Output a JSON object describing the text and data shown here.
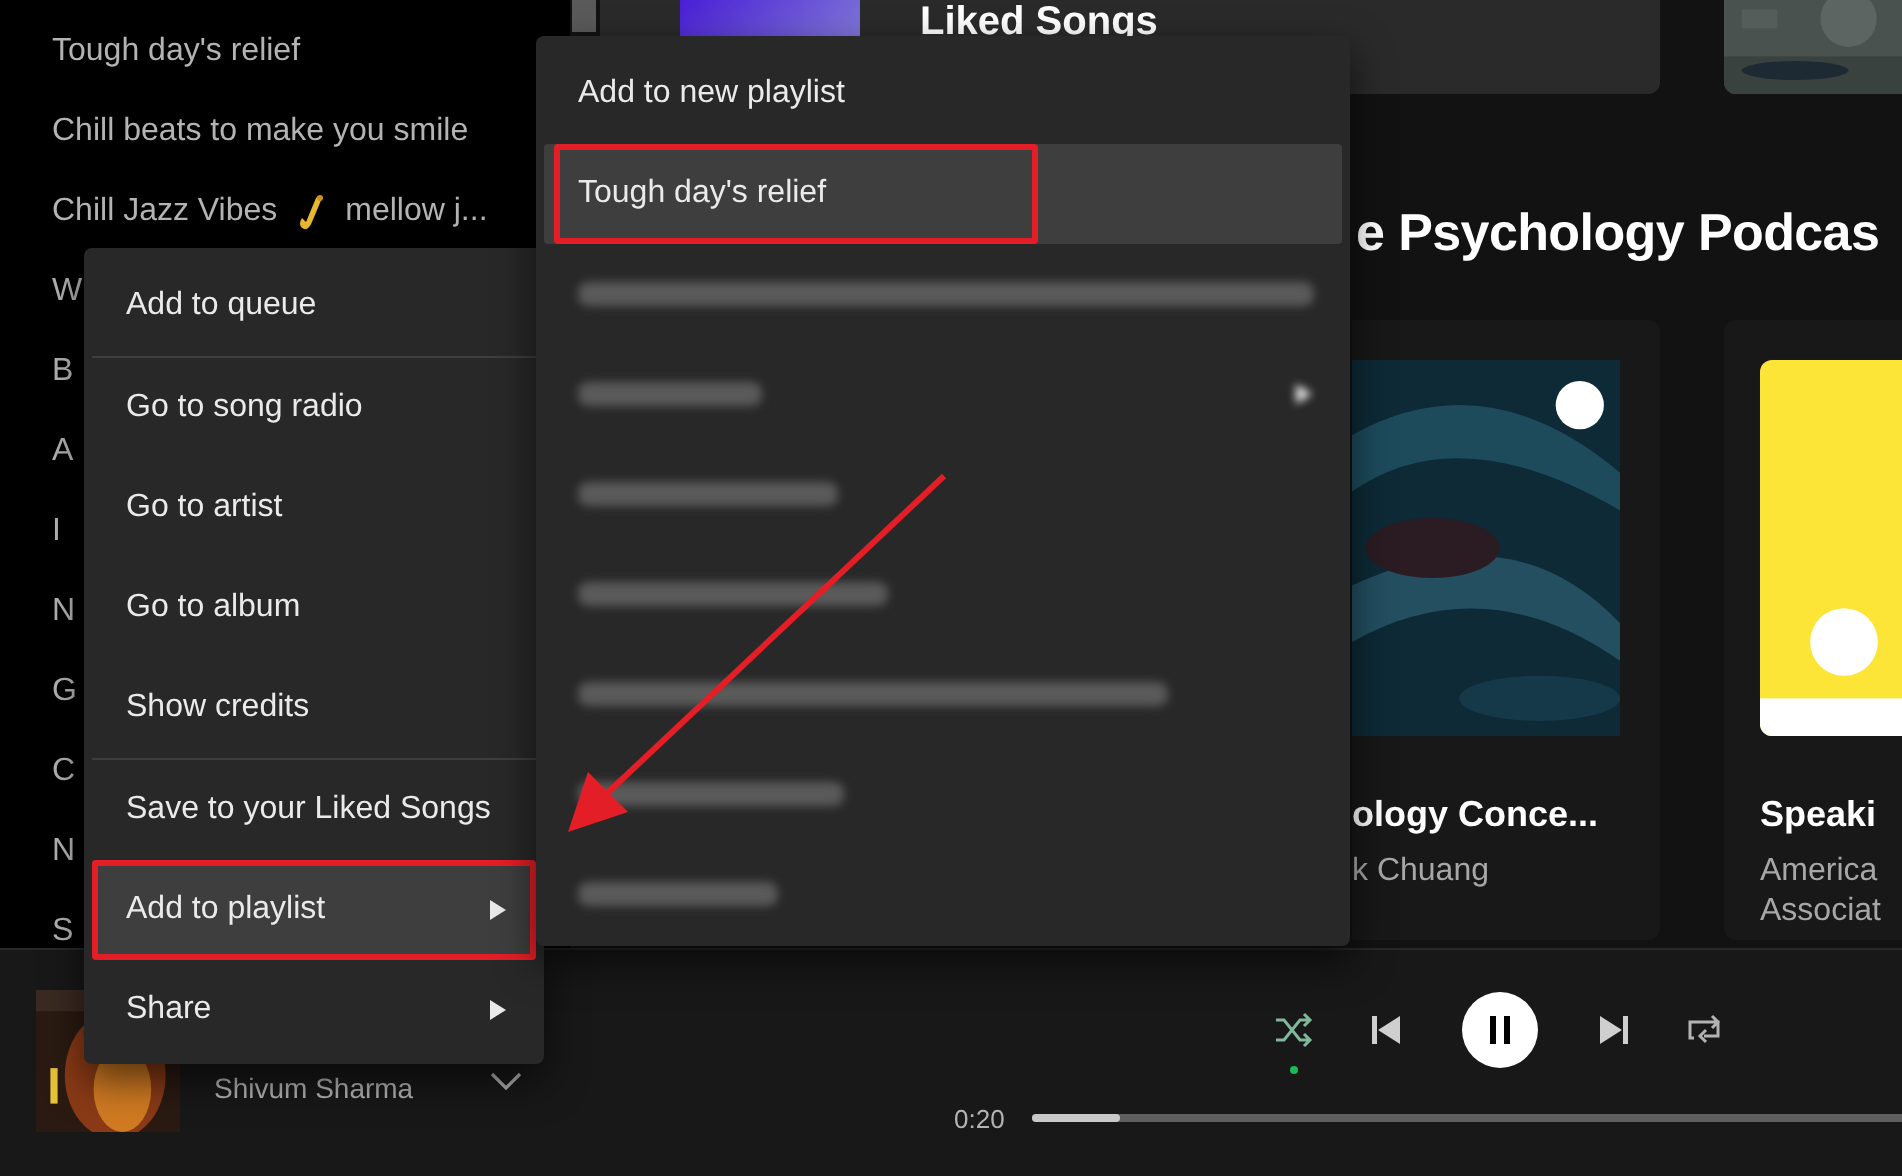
{
  "sidebar": {
    "playlists": [
      {
        "kind": "text",
        "label": "Tough day's relief"
      },
      {
        "kind": "text",
        "label": "Chill beats to make you smile"
      },
      {
        "kind": "with-icon",
        "label": "Chill Jazz Vibes",
        "label_2": "mellow j..."
      },
      {
        "kind": "text",
        "label": "W"
      },
      {
        "kind": "text",
        "label": "B"
      },
      {
        "kind": "text",
        "label": "A"
      },
      {
        "kind": "text",
        "label": "I"
      },
      {
        "kind": "text",
        "label": "N"
      },
      {
        "kind": "text",
        "label": "G"
      },
      {
        "kind": "text",
        "label": "C"
      },
      {
        "kind": "text",
        "label": "N"
      },
      {
        "kind": "text",
        "label": "S"
      }
    ]
  },
  "main": {
    "liked_card": {
      "title": "Liked Songs"
    },
    "section_heading": "e Psychology Podcas",
    "cards": [
      {
        "title": "ology Conce...",
        "subtitle_lines": [
          "k Chuang"
        ]
      },
      {
        "title": "Speaki",
        "subtitle_lines": [
          "America",
          "Associat"
        ]
      }
    ]
  },
  "player": {
    "artist": "Shivum Sharma",
    "shuffle": {
      "on": true
    },
    "playing": true,
    "elapsed": "0:20",
    "progress": {
      "level": 0.1
    }
  },
  "context_menu": {
    "groups": [
      [
        {
          "label": "Add to queue",
          "submenu": false,
          "selected": false,
          "annotated": false
        }
      ],
      [
        {
          "label": "Go to song radio",
          "submenu": false,
          "selected": false,
          "annotated": false
        },
        {
          "label": "Go to artist",
          "submenu": false,
          "selected": false,
          "annotated": false
        },
        {
          "label": "Go to album",
          "submenu": false,
          "selected": false,
          "annotated": false
        },
        {
          "label": "Show credits",
          "submenu": false,
          "selected": false,
          "annotated": false
        }
      ],
      [
        {
          "label": "Save to your Liked Songs",
          "submenu": false,
          "selected": false,
          "annotated": false
        },
        {
          "label": "Add to playlist",
          "submenu": true,
          "selected": true,
          "annotated": true
        },
        {
          "label": "Share",
          "submenu": true,
          "selected": false,
          "annotated": false
        }
      ]
    ]
  },
  "playlist_menu": {
    "items": [
      {
        "kind": "text",
        "label": "Add to new playlist",
        "submenu": false,
        "selected": false,
        "annotated": false
      },
      {
        "kind": "text",
        "label": "Tough day's relief",
        "submenu": false,
        "selected": true,
        "annotated": true
      },
      {
        "kind": "blurred",
        "submenu": false,
        "selected": false,
        "annotated": false
      },
      {
        "kind": "blurred",
        "submenu": true,
        "selected": false,
        "annotated": false
      },
      {
        "kind": "blurred",
        "submenu": false,
        "selected": false,
        "annotated": false
      },
      {
        "kind": "blurred",
        "submenu": false,
        "selected": false,
        "annotated": false
      },
      {
        "kind": "blurred",
        "submenu": false,
        "selected": false,
        "annotated": false
      },
      {
        "kind": "blurred",
        "submenu": false,
        "selected": false,
        "annotated": false
      },
      {
        "kind": "blurred",
        "submenu": false,
        "selected": false,
        "annotated": false
      }
    ]
  },
  "annotation_arrow": true
}
